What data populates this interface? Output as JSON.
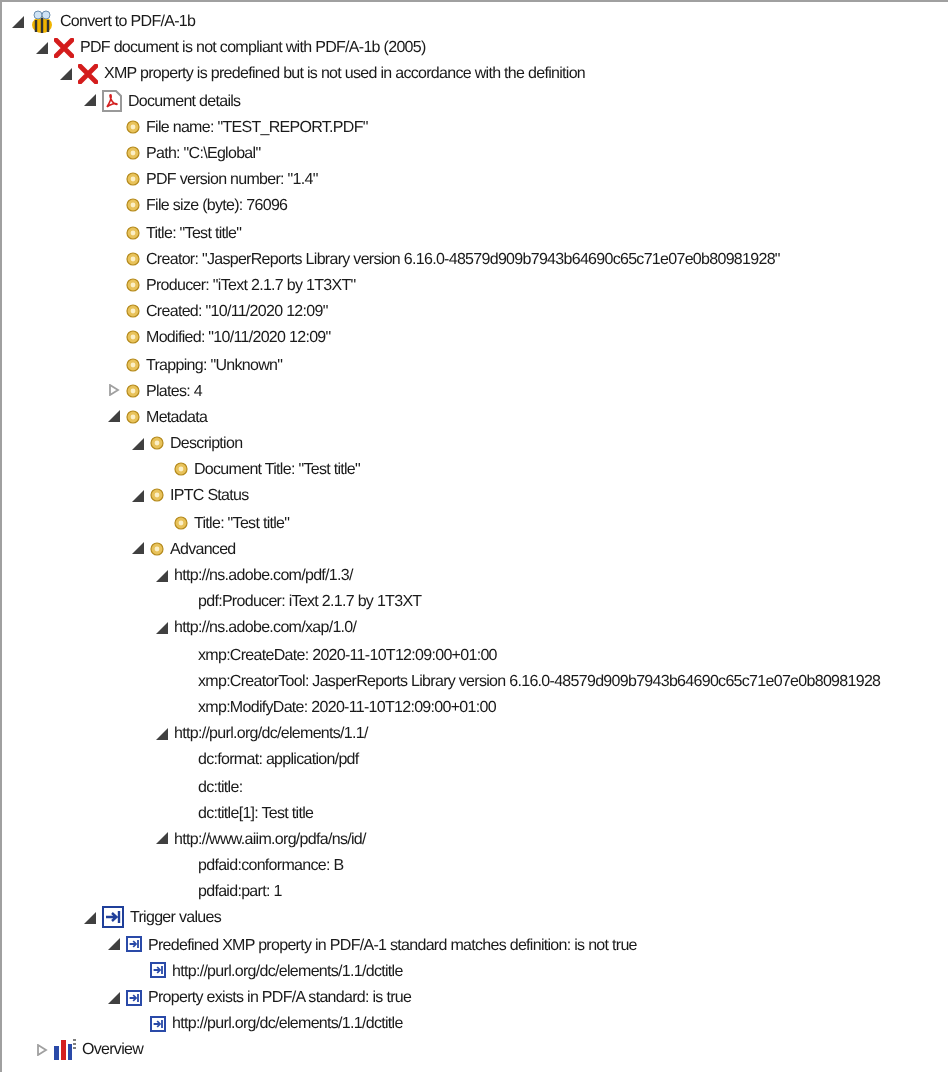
{
  "tree": [
    {
      "label": "Convert to PDF/A-1b",
      "kind": "root",
      "expanded": true,
      "children": [
        {
          "label": "PDF document is not compliant with PDF/A-1b (2005)",
          "kind": "error",
          "expanded": true,
          "children": [
            {
              "label": "XMP property is predefined but is not used in accordance with the definition",
              "kind": "error",
              "expanded": true,
              "children": [
                {
                  "label": "Document details",
                  "kind": "pdf",
                  "expanded": true,
                  "children": [
                    {
                      "label": "File name: \"TEST_REPORT.PDF\"",
                      "kind": "bullet"
                    },
                    {
                      "label": "Path: \"C:\\Eglobal\"",
                      "kind": "bullet"
                    },
                    {
                      "label": "PDF version number: \"1.4\"",
                      "kind": "bullet"
                    },
                    {
                      "label": "File size (byte): 76096",
                      "kind": "bullet"
                    },
                    {
                      "label": "Title: \"Test title\"",
                      "kind": "bullet"
                    },
                    {
                      "label": "Creator: \"JasperReports Library version 6.16.0-48579d909b7943b64690c65c71e07e0b80981928\"",
                      "kind": "bullet"
                    },
                    {
                      "label": "Producer: \"iText 2.1.7 by 1T3XT\"",
                      "kind": "bullet"
                    },
                    {
                      "label": "Created: \"10/11/2020 12:09\"",
                      "kind": "bullet"
                    },
                    {
                      "label": "Modified: \"10/11/2020 12:09\"",
                      "kind": "bullet"
                    },
                    {
                      "label": "Trapping: \"Unknown\"",
                      "kind": "bullet"
                    },
                    {
                      "label": "Plates: 4",
                      "kind": "bullet",
                      "expanded": false
                    },
                    {
                      "label": "Metadata",
                      "kind": "bullet",
                      "expanded": true,
                      "children": [
                        {
                          "label": "Description",
                          "kind": "bullet",
                          "expanded": true,
                          "children": [
                            {
                              "label": "Document Title: \"Test title\"",
                              "kind": "bullet"
                            }
                          ]
                        },
                        {
                          "label": "IPTC Status",
                          "kind": "bullet",
                          "expanded": true,
                          "children": [
                            {
                              "label": "Title: \"Test title\"",
                              "kind": "bullet"
                            }
                          ]
                        },
                        {
                          "label": "Advanced",
                          "kind": "bullet",
                          "expanded": true,
                          "children": [
                            {
                              "label": "http://ns.adobe.com/pdf/1.3/",
                              "expanded": true,
                              "children": [
                                {
                                  "label": "pdf:Producer: iText 2.1.7 by 1T3XT"
                                }
                              ]
                            },
                            {
                              "label": "http://ns.adobe.com/xap/1.0/",
                              "expanded": true,
                              "children": [
                                {
                                  "label": "xmp:CreateDate: 2020-11-10T12:09:00+01:00"
                                },
                                {
                                  "label": "xmp:CreatorTool: JasperReports Library version 6.16.0-48579d909b7943b64690c65c71e07e0b80981928"
                                },
                                {
                                  "label": "xmp:ModifyDate: 2020-11-10T12:09:00+01:00"
                                }
                              ]
                            },
                            {
                              "label": "http://purl.org/dc/elements/1.1/",
                              "expanded": true,
                              "children": [
                                {
                                  "label": "dc:format: application/pdf"
                                },
                                {
                                  "label": "dc:title:"
                                },
                                {
                                  "label": "dc:title[1]: Test title"
                                }
                              ]
                            },
                            {
                              "label": "http://www.aiim.org/pdfa/ns/id/",
                              "expanded": true,
                              "children": [
                                {
                                  "label": "pdfaid:conformance: B"
                                },
                                {
                                  "label": "pdfaid:part: 1"
                                }
                              ]
                            }
                          ]
                        }
                      ]
                    }
                  ]
                },
                {
                  "label": "Trigger values",
                  "kind": "trigger",
                  "expanded": true,
                  "children": [
                    {
                      "label": "Predefined XMP property in PDF/A-1 standard matches definition: is not true",
                      "kind": "trigger-small",
                      "expanded": true,
                      "children": [
                        {
                          "label": "http://purl.org/dc/elements/1.1/dctitle",
                          "kind": "trigger-small"
                        }
                      ]
                    },
                    {
                      "label": "Property exists in PDF/A standard: is true",
                      "kind": "trigger-small",
                      "expanded": true,
                      "children": [
                        {
                          "label": "http://purl.org/dc/elements/1.1/dctitle",
                          "kind": "trigger-small"
                        }
                      ]
                    }
                  ]
                }
              ]
            }
          ]
        },
        {
          "label": "Overview",
          "kind": "chart",
          "expanded": false
        }
      ]
    }
  ]
}
